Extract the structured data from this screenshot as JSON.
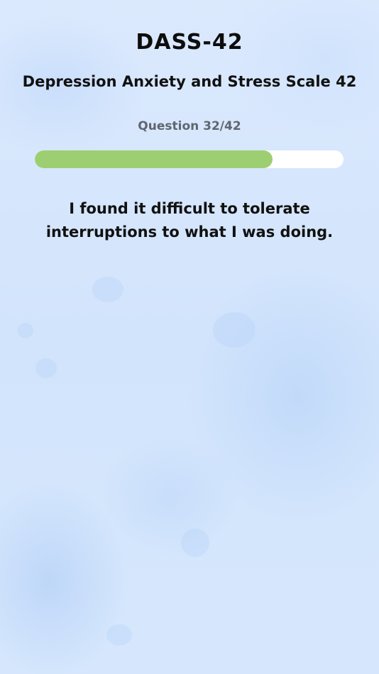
{
  "app": {
    "title": "DASS-42",
    "subtitle": "Depression Anxiety and Stress Scale 42"
  },
  "progress": {
    "counter_label": "Question 32/42",
    "current": 32,
    "total": 42,
    "fill_fraction": 0.77,
    "track_color": "#ffffff",
    "fill_color": "#9dcf72"
  },
  "question": {
    "text": "I found it difficult to tolerate interruptions to what I was doing."
  },
  "theme": {
    "background": "#d6e7fd",
    "text_color": "#111111",
    "muted_text_color": "#5f6670"
  }
}
